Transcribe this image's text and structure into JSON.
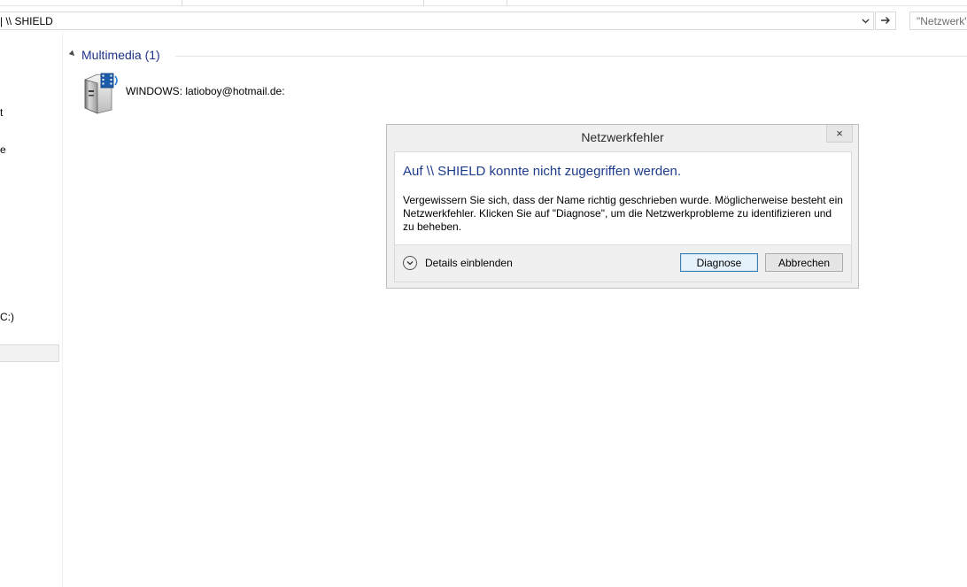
{
  "address_bar": {
    "path": "| \\\\ SHIELD"
  },
  "search": {
    "placeholder": "\"Netzwerk\""
  },
  "nav_pane": {
    "fragments": [
      "t",
      "e",
      "C:)"
    ]
  },
  "content": {
    "group_title": "Multimedia (1)",
    "items": [
      {
        "label": "WINDOWS: latioboy@hotmail.de:",
        "icon": "media-device-icon"
      }
    ]
  },
  "dialog": {
    "title": "Netzwerkfehler",
    "close_symbol": "×",
    "main_instruction": "Auf \\\\ SHIELD konnte nicht zugegriffen werden.",
    "content": "Vergewissern Sie sich, dass der Name richtig geschrieben wurde. Möglicherweise besteht ein Netzwerkfehler. Klicken Sie auf \"Diagnose\", um die Netzwerkprobleme zu identifizieren und zu beheben.",
    "details_label": "Details einblenden",
    "buttons": {
      "diagnose": "Diagnose",
      "cancel": "Abbrechen"
    }
  },
  "colors": {
    "accent_text": "#1e3c8c",
    "group_header": "#1e3287",
    "dialog_bg": "#f0f0f0"
  }
}
